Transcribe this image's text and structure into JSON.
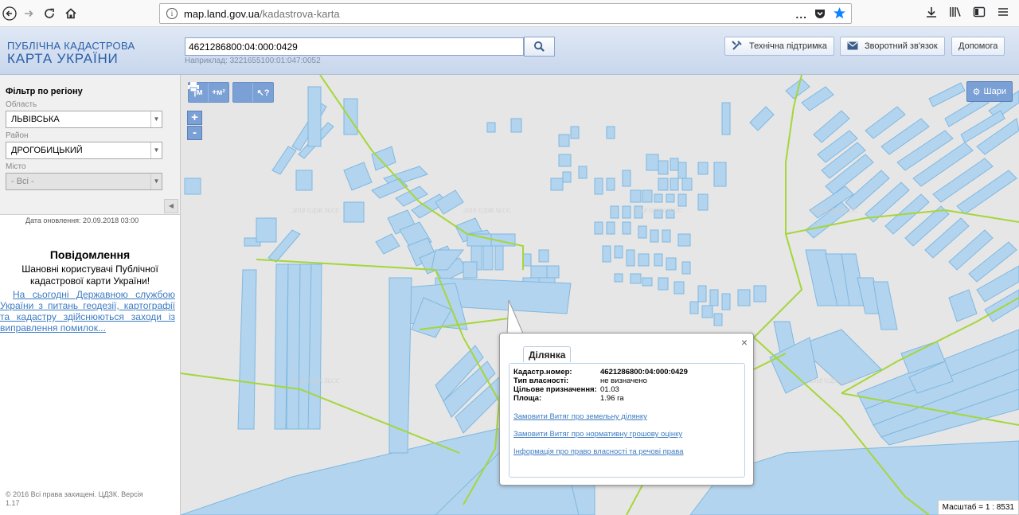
{
  "browser": {
    "url_domain": "map.land.gov.ua",
    "url_path": "/kadastrova-karta",
    "more_icon": "..."
  },
  "header": {
    "logo_line1": "ПУБЛІЧНА КАДАСТРОВА",
    "logo_line2": "КАРТА УКРАЇНИ",
    "search_value": "4621286800:04:000:0429",
    "search_example": "Наприклад: 3221655100:01:047:0052",
    "support_label": "Технічна підтримка",
    "feedback_label": "Зворотний зв'язок",
    "help_label": "Допомога"
  },
  "sidebar": {
    "filter_title": "Фільтр по регіону",
    "region_label": "Область",
    "region_value": "ЛЬВІВСЬКА",
    "district_label": "Район",
    "district_value": "ДРОГОБИЦЬКИЙ",
    "city_label": "Місто",
    "city_value": "- Всі -",
    "update_date": "Дата оновлення: 20.09.2018 03:00",
    "notice_title": "Повідомлення",
    "notice_text": "Шановні користувачі Публічної кадастрової карти України!",
    "notice_link": "На сьогодні Державною службою України з питань геодезії, картографії та кадастру здійснюються заходи із виправлення помилок...",
    "copyright": "© 2016 Всі права захищені. ЦДЗК. Версія 1.17"
  },
  "map": {
    "layers_label": "Шари",
    "scale_text": "Масштаб = 1 : 8531",
    "zoom_in": "+",
    "zoom_out": "-",
    "tool_distance": "|м",
    "tool_area": "+м²",
    "tool_print": "print",
    "tool_identify": "?"
  },
  "popup": {
    "tab_label": "Ділянка",
    "close": "×",
    "rows": [
      {
        "key": "Кадастр.номер:",
        "value": "4621286800:04:000:0429"
      },
      {
        "key": "Тип власності:",
        "value": "не визначено"
      },
      {
        "key": "Цільове призначення:",
        "value": "01.03"
      },
      {
        "key": "Площа:",
        "value": "1.96 га"
      }
    ],
    "links": [
      "Замовити Витяг про земельну ділянку",
      "Замовити Витяг про нормативну грошову оцінку",
      "Інформація про право власності та речові права"
    ]
  },
  "colors": {
    "parcel_fill": "#b3d4ee",
    "parcel_stroke": "#7fb8e0",
    "boundary": "#a5d63a",
    "map_bg": "#e6e6e6",
    "accent": "#7aa0d6"
  }
}
